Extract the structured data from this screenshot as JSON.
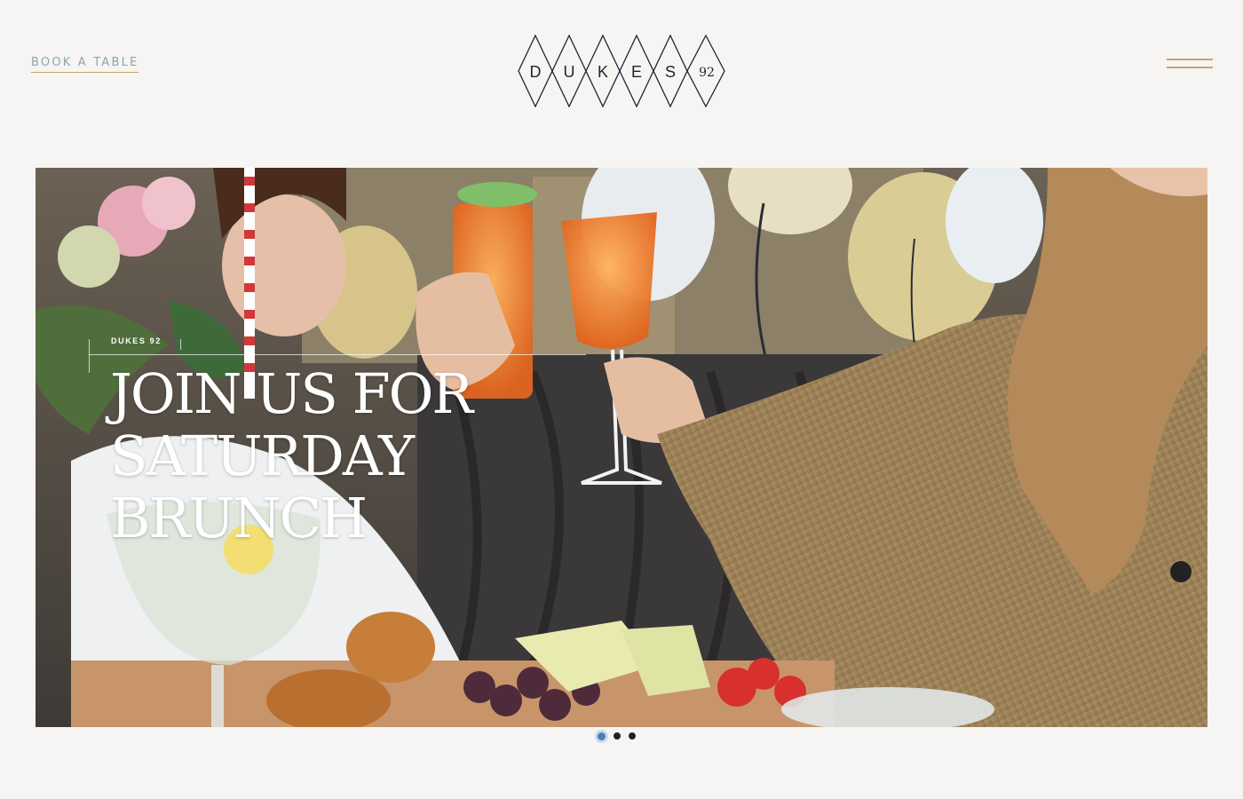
{
  "header": {
    "book_label": "BOOK A TABLE",
    "logo_letters": [
      "D",
      "U",
      "K",
      "E",
      "S",
      "92"
    ],
    "menu_icon": "hamburger-menu-icon"
  },
  "hero": {
    "eyebrow": "DUKES 92",
    "headline_lines": [
      "JOIN US FOR",
      "SATURDAY",
      "BRUNCH"
    ]
  },
  "carousel": {
    "slide_count": 3,
    "active_index": 0
  },
  "colors": {
    "background": "#f6f5f3",
    "gold_accent": "#c2a76e",
    "link_text": "#8fa3ab",
    "logo_stroke": "#1f2430",
    "active_dot": "#4f7cb4"
  }
}
